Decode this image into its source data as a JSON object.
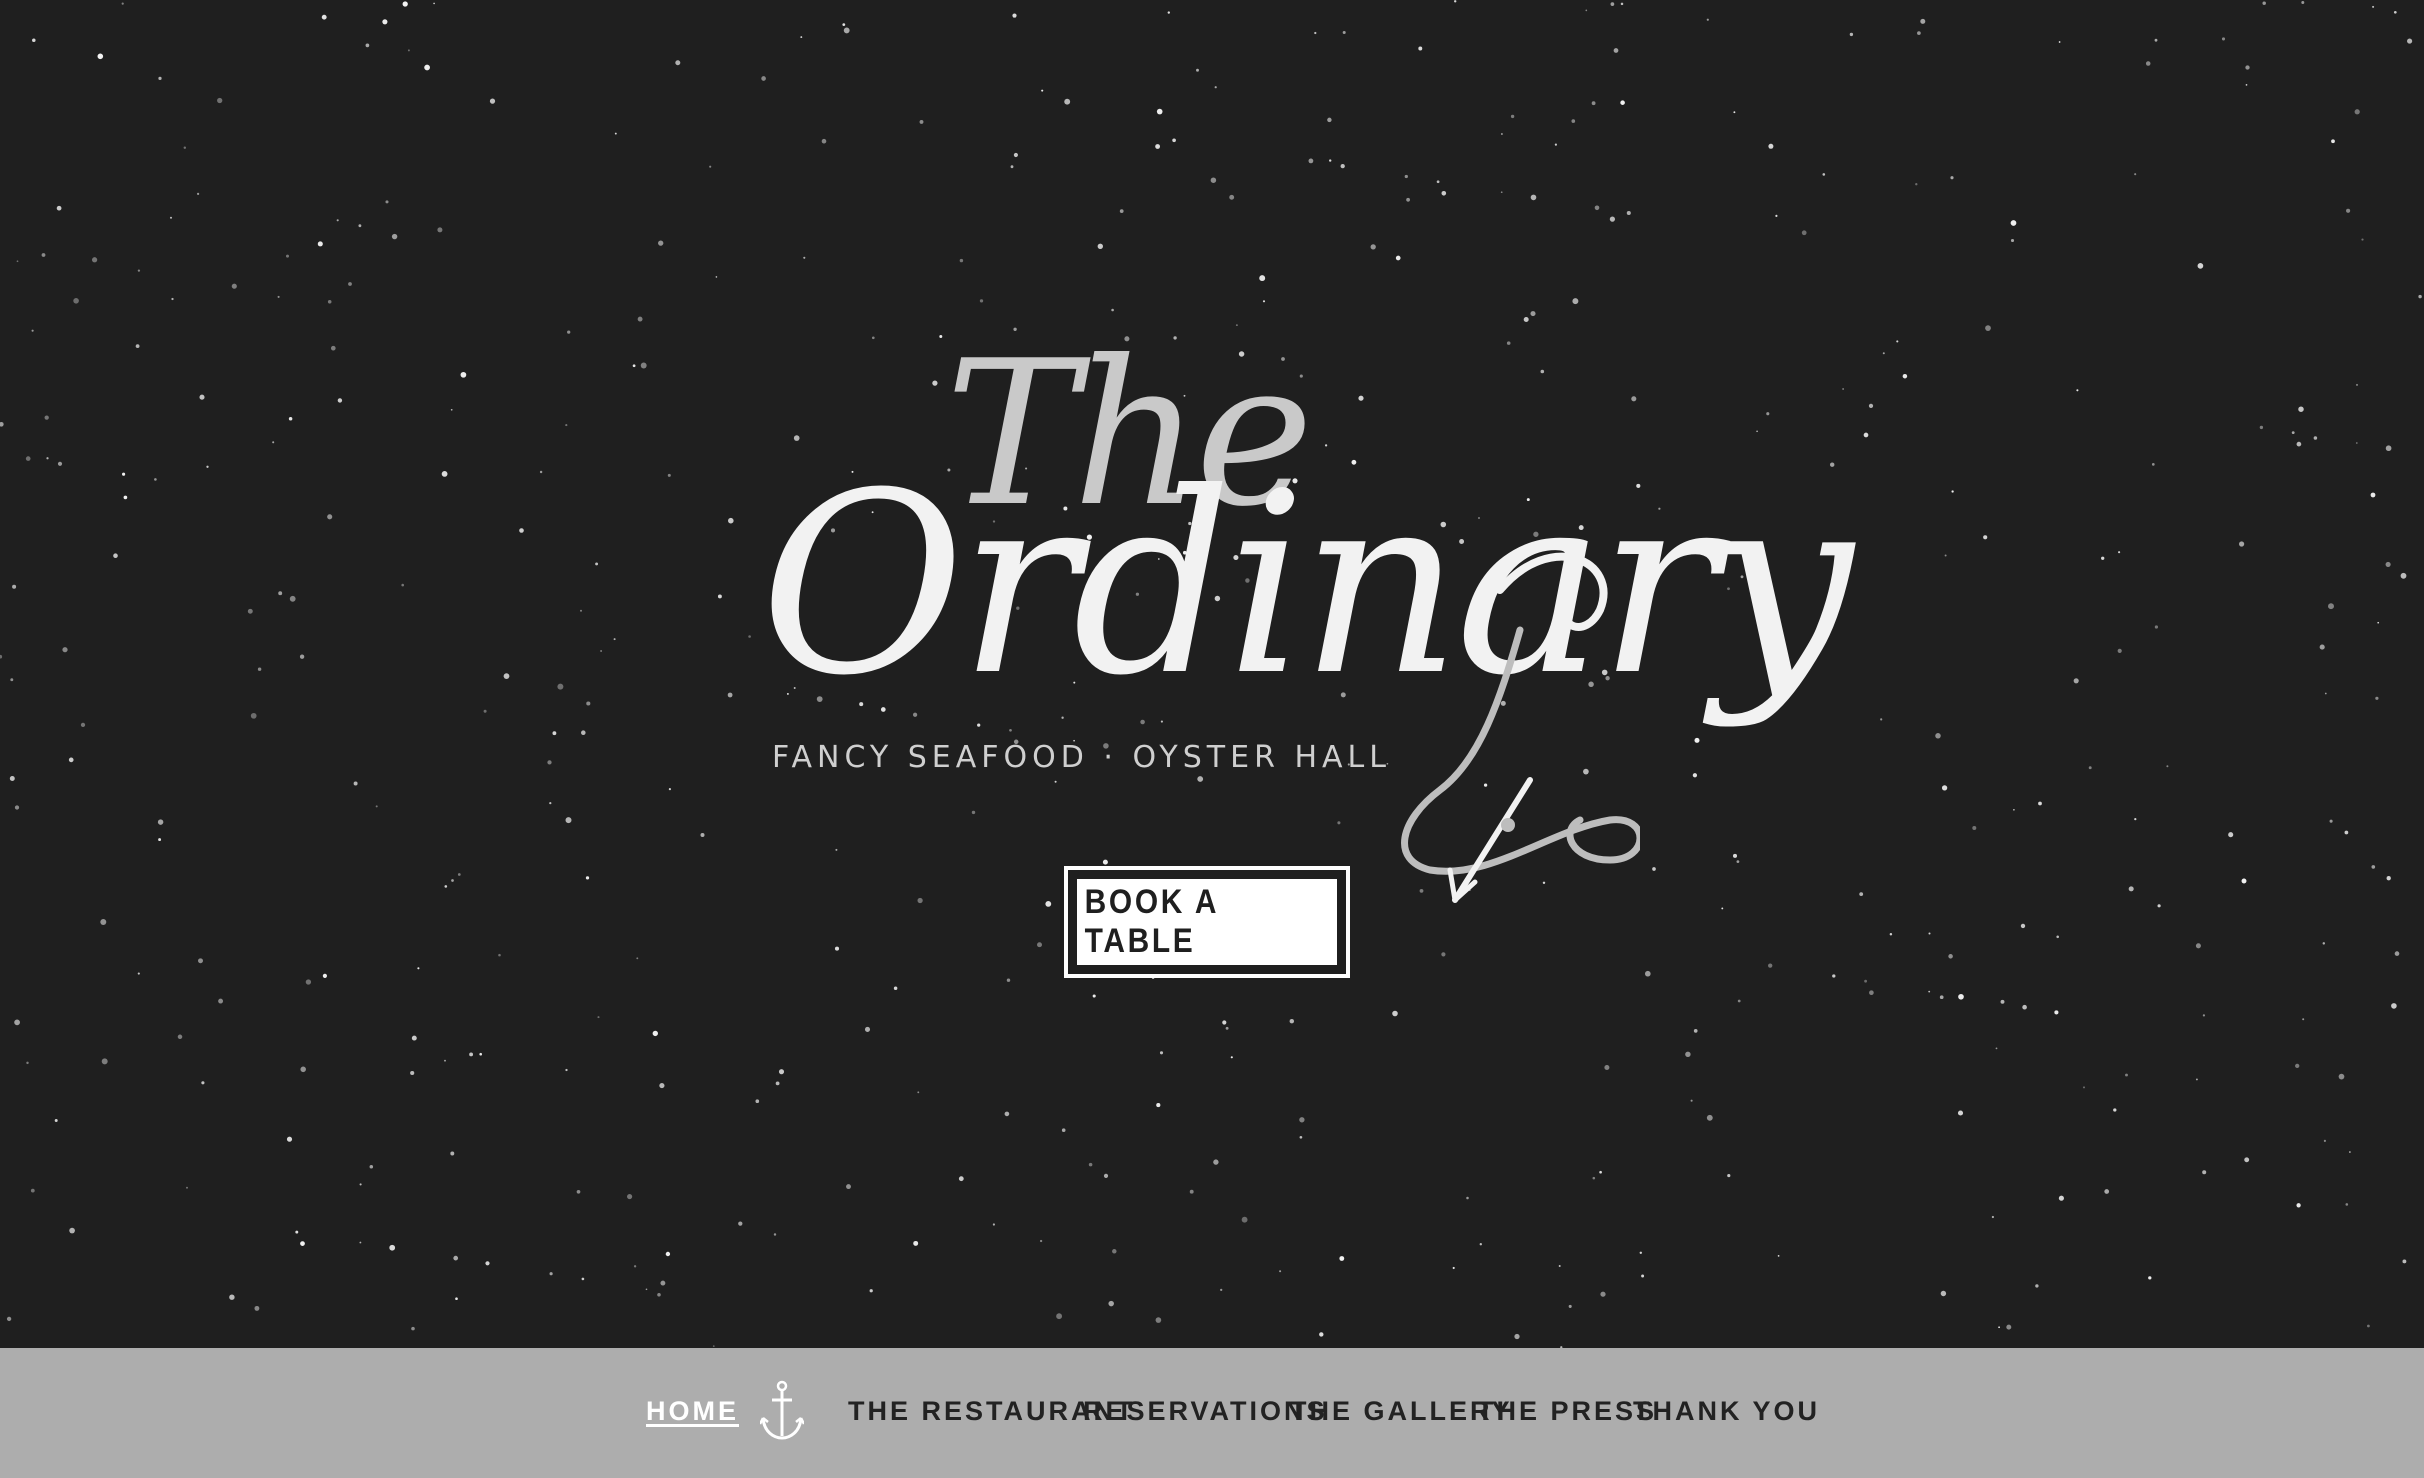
{
  "hero": {
    "logo": {
      "the": "The",
      "name": "Ordinary",
      "tagline": "FANCY SEAFOOD · OYSTER HALL"
    },
    "book_button_label": "BOOK A TABLE"
  },
  "nav": {
    "items": [
      {
        "label": "HOME",
        "active": true
      },
      {
        "label": "THE RESTAURANT",
        "active": false
      },
      {
        "label": "RESERVATIONS",
        "active": false
      },
      {
        "label": "THE GALLERY",
        "active": false
      },
      {
        "label": "THE PRESS",
        "active": false
      },
      {
        "label": "THANK YOU",
        "active": false
      }
    ],
    "center_icon": "anchor-icon"
  },
  "colors": {
    "background": "#1f1f1f",
    "navbar": "#adadad",
    "accent": "#ffffff",
    "nav_text": "#222222"
  }
}
